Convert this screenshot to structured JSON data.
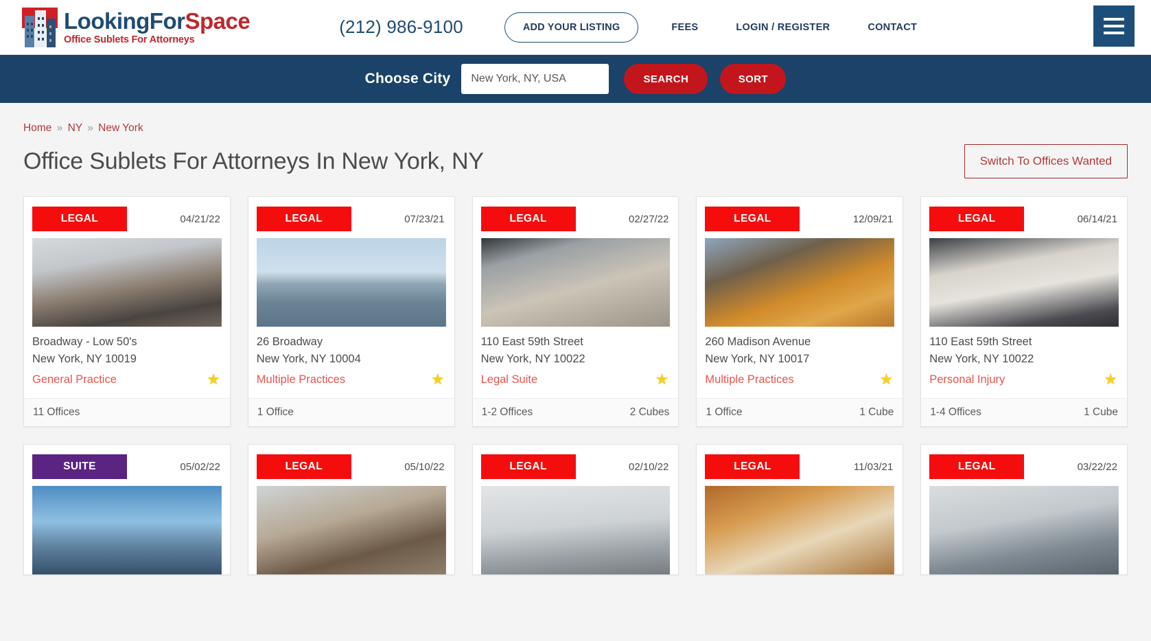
{
  "header": {
    "logo": {
      "name_part1": "LookingFor",
      "name_part2": "Space",
      "tagline": "Office Sublets For Attorneys"
    },
    "phone": "(212) 986-9100",
    "add_listing_label": "ADD YOUR LISTING",
    "nav": [
      {
        "label": "FEES"
      },
      {
        "label": "LOGIN / REGISTER"
      },
      {
        "label": "CONTACT"
      }
    ],
    "menu_icon": "hamburger-menu-icon"
  },
  "search": {
    "label": "Choose City",
    "city_value": "New York, NY, USA",
    "city_placeholder": "New York, NY, USA",
    "search_label": "SEARCH",
    "sort_label": "SORT"
  },
  "breadcrumb": {
    "home": "Home",
    "state": "NY",
    "city": "New York",
    "separator": "»"
  },
  "page": {
    "title": "Office Sublets For Attorneys In New York, NY",
    "switch_label": "Switch To Offices Wanted"
  },
  "colors": {
    "navy": "#1b4268",
    "header_navy": "#1d4e79",
    "red_button": "#c3161c",
    "badge_legal": "#f50d0d",
    "badge_suite": "#5b2382",
    "link_red": "#b0393c",
    "practice_red": "#e8534a",
    "star_gold": "#f7ce23",
    "page_bg": "#f4f4f4"
  },
  "listings": [
    {
      "badge": "LEGAL",
      "badge_type": "legal",
      "date": "04/21/22",
      "address1": "Broadway - Low 50's",
      "address2": "New York, NY 10019",
      "practice": "General Practice",
      "star": "★",
      "offices": "11 Offices",
      "cubes": "",
      "photo": "ph-a"
    },
    {
      "badge": "LEGAL",
      "badge_type": "legal",
      "date": "07/23/21",
      "address1": "26 Broadway",
      "address2": "New York, NY 10004",
      "practice": "Multiple Practices",
      "star": "★",
      "offices": "1 Office",
      "cubes": "",
      "photo": "ph-b"
    },
    {
      "badge": "LEGAL",
      "badge_type": "legal",
      "date": "02/27/22",
      "address1": "110 East 59th Street",
      "address2": "New York, NY 10022",
      "practice": "Legal Suite",
      "star": "★",
      "offices": "1-2 Offices",
      "cubes": "2 Cubes",
      "photo": "ph-c2"
    },
    {
      "badge": "LEGAL",
      "badge_type": "legal",
      "date": "12/09/21",
      "address1": "260 Madison Avenue",
      "address2": "New York, NY 10017",
      "practice": "Multiple Practices",
      "star": "★",
      "offices": "1 Office",
      "cubes": "1 Cube",
      "photo": "ph-d"
    },
    {
      "badge": "LEGAL",
      "badge_type": "legal",
      "date": "06/14/21",
      "address1": "110 East 59th Street",
      "address2": "New York, NY 10022",
      "practice": "Personal Injury",
      "star": "★",
      "offices": "1-4 Offices",
      "cubes": "1 Cube",
      "photo": "ph-e"
    },
    {
      "badge": "SUITE",
      "badge_type": "suite",
      "date": "05/02/22",
      "address1": "",
      "address2": "",
      "practice": "",
      "star": "",
      "offices": "",
      "cubes": "",
      "photo": "ph-f"
    },
    {
      "badge": "LEGAL",
      "badge_type": "legal",
      "date": "05/10/22",
      "address1": "",
      "address2": "",
      "practice": "",
      "star": "",
      "offices": "",
      "cubes": "",
      "photo": "ph-g"
    },
    {
      "badge": "LEGAL",
      "badge_type": "legal",
      "date": "02/10/22",
      "address1": "",
      "address2": "",
      "practice": "",
      "star": "",
      "offices": "",
      "cubes": "",
      "photo": "ph-h"
    },
    {
      "badge": "LEGAL",
      "badge_type": "legal",
      "date": "11/03/21",
      "address1": "",
      "address2": "",
      "practice": "",
      "star": "",
      "offices": "",
      "cubes": "",
      "photo": "ph-i"
    },
    {
      "badge": "LEGAL",
      "badge_type": "legal",
      "date": "03/22/22",
      "address1": "",
      "address2": "",
      "practice": "",
      "star": "",
      "offices": "",
      "cubes": "",
      "photo": "ph-j"
    }
  ]
}
